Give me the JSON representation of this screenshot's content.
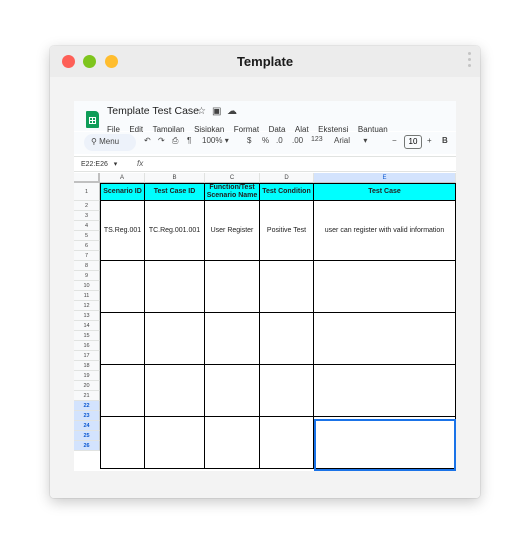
{
  "window": {
    "title": "Template"
  },
  "doc": {
    "title": "Template Test Case",
    "menus": [
      "File",
      "Edit",
      "Tampilan",
      "Sisipkan",
      "Format",
      "Data",
      "Alat",
      "Ekstensi",
      "Bantuan"
    ]
  },
  "toolbar": {
    "search_label": "Menu",
    "zoom": "100%",
    "currency": "$",
    "percent": "%",
    "dec_decrease": ".0",
    "dec_increase": ".00",
    "number_format": "123",
    "font": "Arial",
    "font_size": "10",
    "bold": "B"
  },
  "formula_bar": {
    "name_box": "E22:E26",
    "fx": "fx",
    "value": ""
  },
  "columns": [
    "A",
    "B",
    "C",
    "D",
    "E"
  ],
  "rows": [
    "1",
    "2",
    "3",
    "4",
    "5",
    "6",
    "7",
    "8",
    "9",
    "10",
    "11",
    "12",
    "13",
    "14",
    "15",
    "16",
    "17",
    "18",
    "19",
    "20",
    "21",
    "22",
    "23",
    "24",
    "25",
    "26"
  ],
  "table": {
    "headers": [
      "Scenario ID",
      "Test Case ID",
      "Function/Test Scenario Name",
      "Test Condition",
      "Test Case"
    ],
    "rows": [
      [
        "TS.Reg.001",
        "TC.Reg.001.001",
        "User Register",
        "Positive Test",
        "user can register with valid information"
      ],
      [
        "",
        "",
        "",
        "",
        ""
      ],
      [
        "",
        "",
        "",
        "",
        ""
      ],
      [
        "",
        "",
        "",
        "",
        ""
      ],
      [
        "",
        "",
        "",
        "",
        ""
      ]
    ]
  },
  "selection": {
    "column": "E",
    "rows": "22-26"
  }
}
